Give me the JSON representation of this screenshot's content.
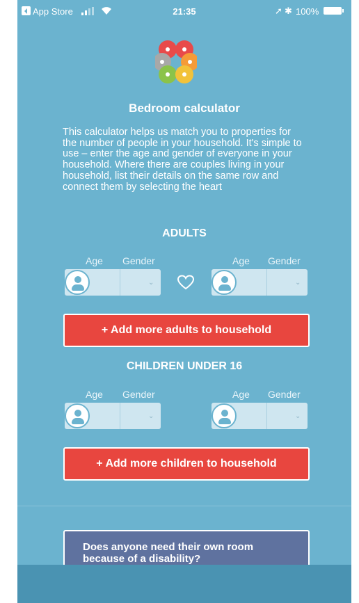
{
  "status_bar": {
    "back_app": "App Store",
    "time": "21:35",
    "battery": "100%"
  },
  "logo": {
    "name": "flower-logo"
  },
  "page": {
    "title": "Bedroom calculator",
    "intro": "This calculator helps us match you to properties for the number of people in your household. It's simple to use – enter the age and gender of everyone in your household. Where there are couples living in your household, list their details on the same row and connect them by selecting the heart"
  },
  "adults": {
    "heading": "ADULTS",
    "age_label": "Age",
    "gender_label": "Gender",
    "add_button": "+ Add more adults to household"
  },
  "children": {
    "heading": "CHILDREN UNDER 16",
    "age_label": "Age",
    "gender_label": "Gender",
    "add_button": "+ Add more children to household"
  },
  "question_card": {
    "text": "Does anyone need their own room because of a disability?"
  },
  "colors": {
    "background": "#6bb3cf",
    "accent_button": "#e8463f",
    "card": "#5f729f",
    "field": "#cfe6f0"
  },
  "icons": [
    "person-icon",
    "chevron-down-icon",
    "heart-icon",
    "flower-logo"
  ]
}
